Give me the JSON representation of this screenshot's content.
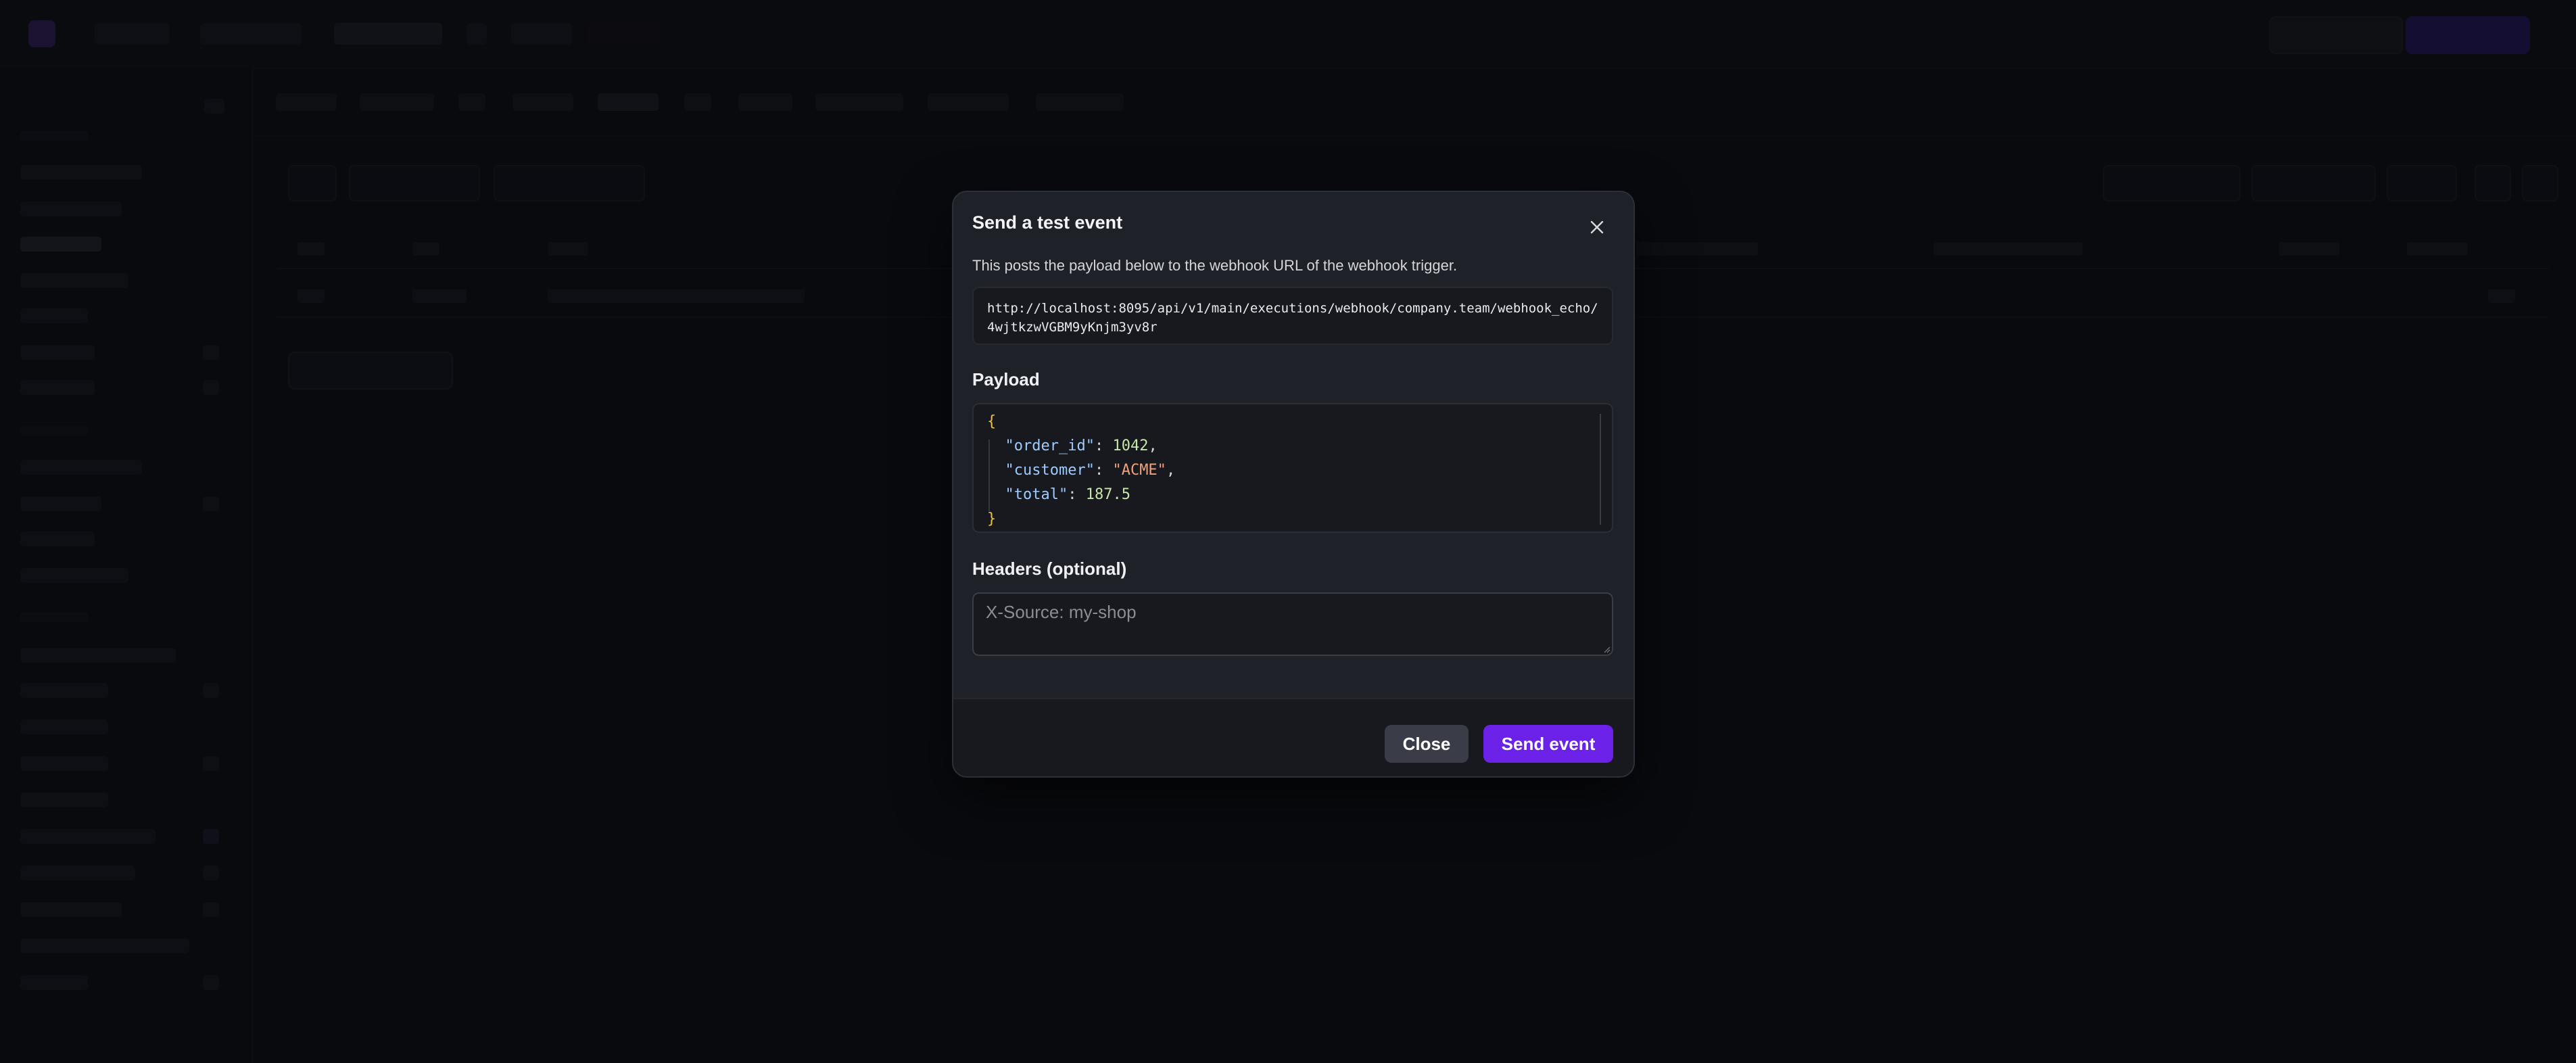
{
  "dialog": {
    "title": "Send a test event",
    "description": "This posts the payload below to the webhook URL of the webhook trigger.",
    "webhook_url": "http://localhost:8095/api/v1/main/executions/webhook/company.team/webhook_echo/4wjtkzwVGBM9yKnjm3yv8r",
    "payload_label": "Payload",
    "payload": {
      "open_brace": "{",
      "close_brace": "}",
      "lines": [
        {
          "key": "\"order_id\"",
          "sep": ": ",
          "value": "1042",
          "value_type": "number",
          "trail": ","
        },
        {
          "key": "\"customer\"",
          "sep": ": ",
          "value": "\"ACME\"",
          "value_type": "string",
          "trail": ","
        },
        {
          "key": "\"total\"",
          "sep": ": ",
          "value": "187.5",
          "value_type": "number",
          "trail": ""
        }
      ]
    },
    "headers_label": "Headers (optional)",
    "headers_placeholder": "X-Source: my-shop",
    "headers_value": "",
    "close_label": "Close",
    "send_label": "Send event",
    "close_icon": "close-icon"
  },
  "colors": {
    "accent": "#6b21e8",
    "json_key": "#9ecbff",
    "json_number": "#c7e6a8",
    "json_string": "#f0a27a",
    "json_brace": "#e6c24b"
  }
}
